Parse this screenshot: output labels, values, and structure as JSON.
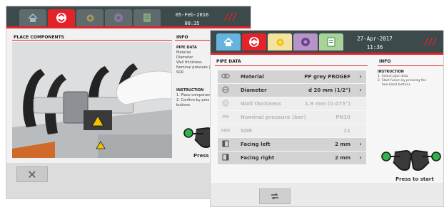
{
  "back_window": {
    "date": "05-Feb-2016",
    "time": "00:35",
    "heat_icon": "heat-icon",
    "title": "PLACE COMPONENTS",
    "info_title": "INFO",
    "pipe_data_heading": "PIPE DATA",
    "pipe_data_lines": [
      "Material",
      "Diameter",
      "Wall thickness",
      "Nominal pressure (b",
      "SDR"
    ],
    "instruction_heading": "INSTRUCTION",
    "instruction_lines": [
      "1. Place componen",
      "2. Confirm by pres",
      "buttons"
    ],
    "press_label": "Press",
    "cancel_icon": "close-icon",
    "cancel_symbol": "✕"
  },
  "front_window": {
    "date": "27-Apr-2017",
    "time": "11:36",
    "heat_icon": "heat-icon",
    "title": "PIPE DATA",
    "info_title": "INFO",
    "instruction_heading": "INSTRUCTION",
    "instruction_lines": [
      "1. Select pipe data",
      "2. Start fusion by pressing the",
      "two-hand buttons"
    ],
    "press_label": "Press to start",
    "swap_icon": "swap-icon",
    "rows": [
      {
        "label": "Material",
        "value": "PP grey PROGEF",
        "enabled": true,
        "icon": "material-icon"
      },
      {
        "label": "Diameter",
        "value": "d 20 mm (1/2\")",
        "enabled": true,
        "icon": "diameter-icon"
      },
      {
        "label": "Wall thickness",
        "value": "1.9 mm (0.075\")",
        "enabled": false,
        "icon": "wall-icon"
      },
      {
        "label": "Nominal pressure (bar)",
        "value": "PN10",
        "enabled": false,
        "icon": "pn-icon"
      },
      {
        "label": "SDR",
        "value": "11",
        "enabled": false,
        "icon": "sdr-icon"
      },
      {
        "label": "Facing left",
        "value": "2 mm",
        "enabled": true,
        "icon": "facing-left-icon"
      },
      {
        "label": "Facing right",
        "value": "2 mm",
        "enabled": true,
        "icon": "facing-right-icon"
      }
    ],
    "row_icon_text": [
      "",
      "",
      "",
      "PN",
      "SDR",
      "",
      ""
    ],
    "chevron": "›"
  },
  "colors": {
    "header": "#3d4a4c",
    "accent": "#e2232a"
  }
}
